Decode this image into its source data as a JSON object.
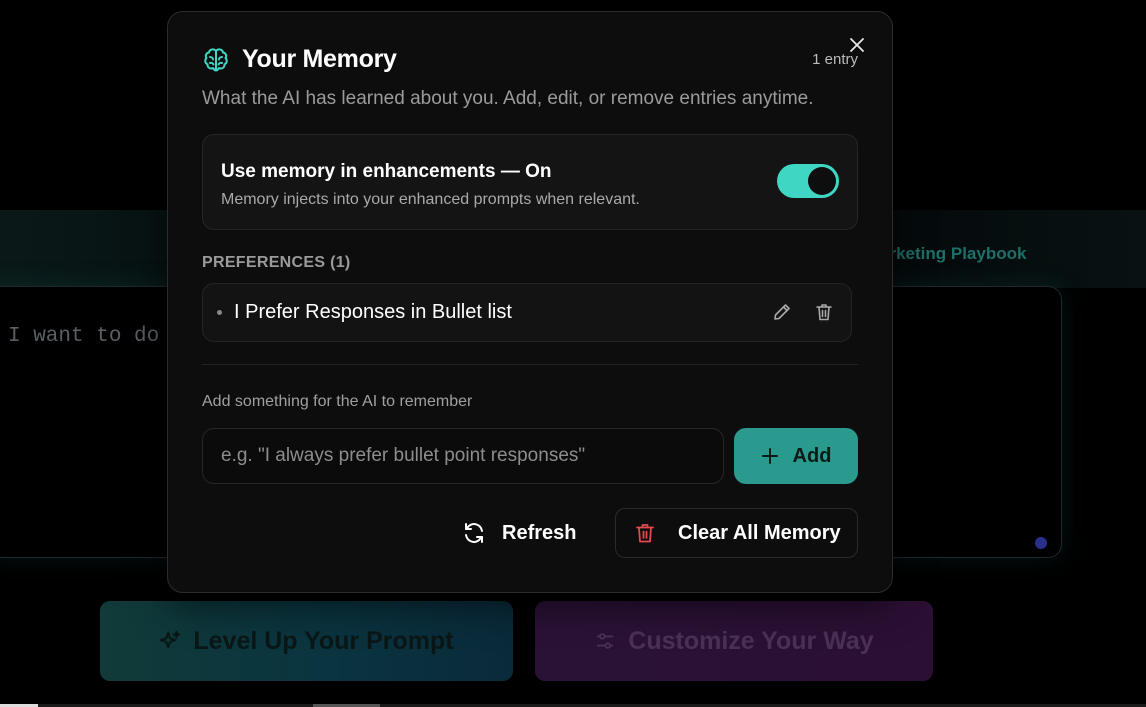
{
  "background": {
    "tag_text": "arketing Playbook",
    "editor_text": "I want to do",
    "level_up_label": "Level Up Your Prompt",
    "customize_label": "Customize Your Way"
  },
  "modal": {
    "title": "Your Memory",
    "entry_count": "1 entry",
    "subtitle": "What the AI has learned about you. Add, edit, or remove entries anytime.",
    "toggle": {
      "title": "Use memory in enhancements — On",
      "description": "Memory injects into your enhanced prompts when relevant.",
      "state": "on"
    },
    "preferences_label": "PREFERENCES (1)",
    "preferences": [
      {
        "text": "I Prefer Responses in Bullet list"
      }
    ],
    "add_label": "Add something for the AI to remember",
    "add_placeholder": "e.g. \"I always prefer bullet point responses\"",
    "add_button": "Add",
    "refresh_button": "Refresh",
    "clear_button": "Clear All Memory"
  },
  "colors": {
    "accent": "#3fd6c4",
    "add_button": "#2a9a8e",
    "danger_icon": "#e5484d",
    "modal_bg": "#0d0d0d"
  },
  "icons": {
    "title": "brain-icon",
    "close": "close-icon",
    "edit": "pencil-icon",
    "delete": "trash-icon",
    "add": "plus-icon",
    "refresh": "refresh-icon",
    "clear": "trash-icon",
    "level_up": "sparkles-icon",
    "customize": "sliders-icon"
  }
}
